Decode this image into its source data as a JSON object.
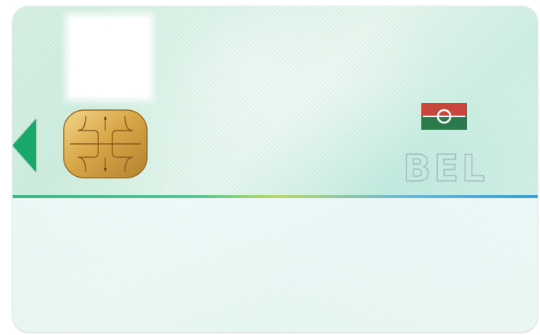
{
  "card": {
    "country_code": "BEL",
    "colors": {
      "arrow": "#1aa86a",
      "emblem_red": "#c8453c",
      "emblem_green": "#2c7a4c",
      "chip_gold": "#d9a84a",
      "divider_start": "#3fb58a",
      "divider_end": "#3a9fd0"
    },
    "icons": {
      "arrow": "insertion-arrow-icon",
      "chip": "smart-chip-icon",
      "emblem": "flag-emblem-icon"
    }
  }
}
